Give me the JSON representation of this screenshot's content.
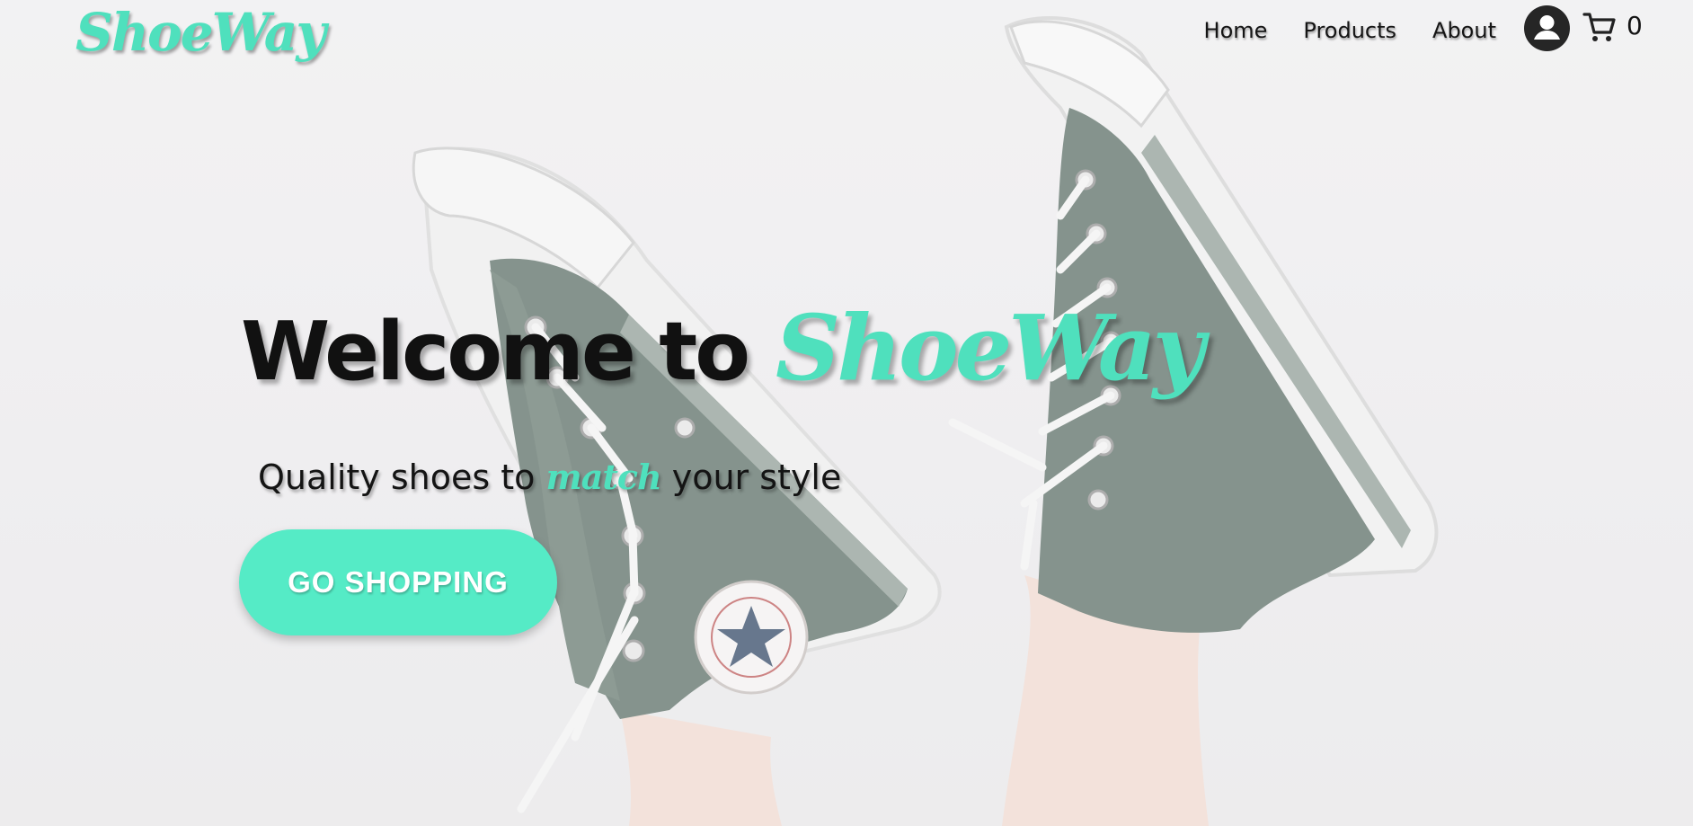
{
  "header": {
    "logo": "ShoeWay",
    "nav": [
      {
        "label": "Home"
      },
      {
        "label": "Products"
      },
      {
        "label": "About"
      }
    ],
    "cart_count": "0"
  },
  "hero": {
    "title_lead": "Welcome to",
    "title_brand": "ShoeWay",
    "tagline_before": "Quality shoes to ",
    "tagline_accent": "match",
    "tagline_after": " your style",
    "cta_label": "GO SHOPPING"
  },
  "icons": {
    "account": "account-circle-icon",
    "cart": "shopping-cart-icon"
  },
  "colors": {
    "accent": "#4fe0bd",
    "button": "#55ebc6",
    "text": "#111111",
    "sneaker_canvas": "#6b7c74",
    "background": "#ecebed"
  }
}
